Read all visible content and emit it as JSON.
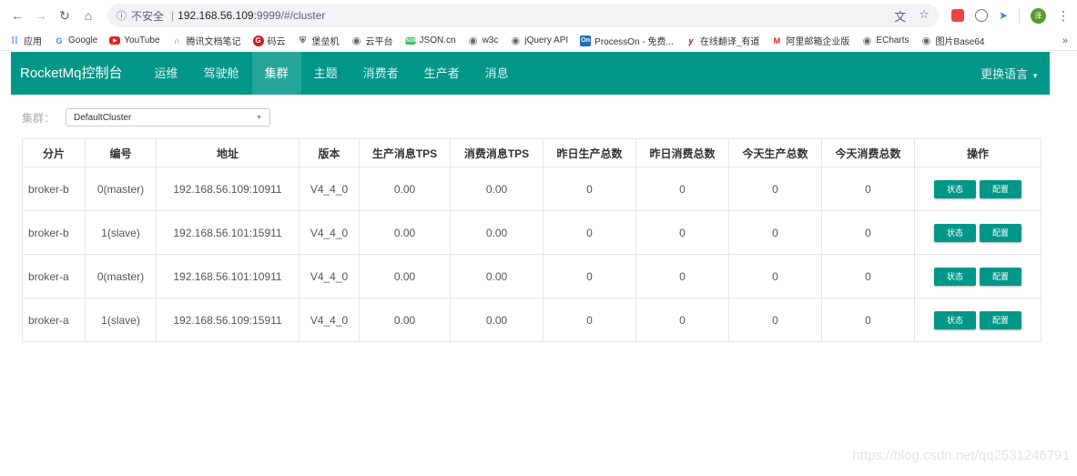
{
  "browser": {
    "url_secure_label": "不安全",
    "url_host": "192.168.56.109",
    "url_path": ":9999/#/cluster",
    "bookmarks": [
      {
        "label": "应用",
        "icon": "apps-grid-icon"
      },
      {
        "label": "Google",
        "icon": "google-icon"
      },
      {
        "label": "YouTube",
        "icon": "youtube-icon"
      },
      {
        "label": "腾讯文档笔记",
        "icon": "tencent-docs-icon"
      },
      {
        "label": "码云",
        "icon": "gitee-icon"
      },
      {
        "label": "堡垒机",
        "icon": "shield-icon"
      },
      {
        "label": "云平台",
        "icon": "globe-icon"
      },
      {
        "label": "JSON.cn",
        "icon": "json-icon"
      },
      {
        "label": "w3c",
        "icon": "globe-icon"
      },
      {
        "label": "jQuery API",
        "icon": "globe-icon"
      },
      {
        "label": "ProcessOn - 免费...",
        "icon": "processon-icon"
      },
      {
        "label": "在线翻译_有道",
        "icon": "youdao-icon"
      },
      {
        "label": "阿里邮箱企业版",
        "icon": "mail-icon"
      },
      {
        "label": "ECharts",
        "icon": "globe-icon"
      },
      {
        "label": "图片Base64",
        "icon": "globe-icon"
      }
    ],
    "avatar_text": "泽"
  },
  "navbar": {
    "brand": "RocketMq控制台",
    "items": [
      {
        "label": "运维",
        "active": false
      },
      {
        "label": "驾驶舱",
        "active": false
      },
      {
        "label": "集群",
        "active": true
      },
      {
        "label": "主题",
        "active": false
      },
      {
        "label": "消费者",
        "active": false
      },
      {
        "label": "生产者",
        "active": false
      },
      {
        "label": "消息",
        "active": false
      }
    ],
    "language": "更换语言"
  },
  "filter": {
    "label": "集群：",
    "selected": "DefaultCluster"
  },
  "table": {
    "headers": [
      "分片",
      "编号",
      "地址",
      "版本",
      "生产消息TPS",
      "消费消息TPS",
      "昨日生产总数",
      "昨日消费总数",
      "今天生产总数",
      "今天消费总数",
      "操作"
    ],
    "rows": [
      {
        "shard": "broker-b",
        "id": "0(master)",
        "address": "192.168.56.109:10911",
        "version": "V4_4_0",
        "produce_tps": "0.00",
        "consume_tps": "0.00",
        "yesterday_produce": "0",
        "yesterday_consume": "0",
        "today_produce": "0",
        "today_consume": "0"
      },
      {
        "shard": "broker-b",
        "id": "1(slave)",
        "address": "192.168.56.101:15911",
        "version": "V4_4_0",
        "produce_tps": "0.00",
        "consume_tps": "0.00",
        "yesterday_produce": "0",
        "yesterday_consume": "0",
        "today_produce": "0",
        "today_consume": "0"
      },
      {
        "shard": "broker-a",
        "id": "0(master)",
        "address": "192.168.56.101:10911",
        "version": "V4_4_0",
        "produce_tps": "0.00",
        "consume_tps": "0.00",
        "yesterday_produce": "0",
        "yesterday_consume": "0",
        "today_produce": "0",
        "today_consume": "0"
      },
      {
        "shard": "broker-a",
        "id": "1(slave)",
        "address": "192.168.56.109:15911",
        "version": "V4_4_0",
        "produce_tps": "0.00",
        "consume_tps": "0.00",
        "yesterday_produce": "0",
        "yesterday_consume": "0",
        "today_produce": "0",
        "today_consume": "0"
      }
    ],
    "actions": {
      "status": "状态",
      "config": "配置"
    }
  },
  "watermark": "https://blog.csdn.net/qq2531246791",
  "colors": {
    "primary": "#009688",
    "active_tab": "#26a69a"
  }
}
